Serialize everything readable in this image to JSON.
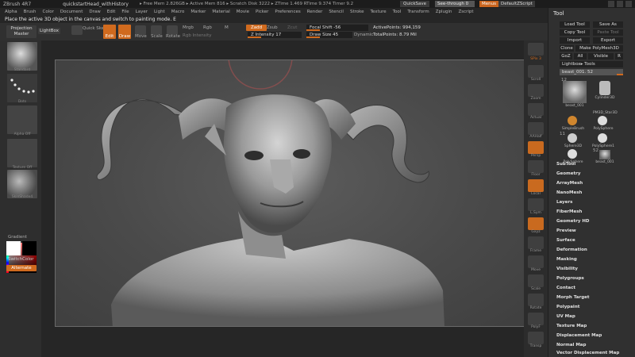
{
  "titlebar": {
    "app": "ZBrush 4R7",
    "file": "quickstartHead_withHistory",
    "stats": "▸ Free Mem 2.826GB ▸ Active Mem 816 ▸ Scratch Disk 3222 ▸ ZTime 1.469 RTime 9.374 Timer 9.2",
    "quicksave": "QuickSave",
    "seethrough": "See-through  0",
    "menus": "Menus",
    "default_script": "DefaultZScript"
  },
  "menubar": [
    "Alpha",
    "Brush",
    "Color",
    "Document",
    "Draw",
    "Edit",
    "File",
    "Layer",
    "Light",
    "Macro",
    "Marker",
    "Material",
    "Movie",
    "Picker",
    "Preferences",
    "Render",
    "Stencil",
    "Stroke",
    "Texture",
    "Tool",
    "Transform",
    "Zplugin",
    "Zscript"
  ],
  "message": "Place the active 3D object in the canvas and switch to painting mode. E",
  "shelf": {
    "projection_master": "Projection Master",
    "lightbox": "LightBox",
    "quick_sketch": "Quick Sketch",
    "edit": "Edit",
    "draw": "Draw",
    "move": "Move",
    "scale": "Scale",
    "rotate": "Rotate",
    "mrgb": "Mrgb",
    "rgb": "Rgb",
    "m": "M",
    "rgb_intensity": "Rgb Intensity",
    "zadd": "Zadd",
    "zsub": "Zsub",
    "zcut": "Zcut",
    "z_intensity": "Z Intensity 17",
    "focal_shift": "Focal Shift -56",
    "draw_size": "Draw Size 45",
    "dynamic": "Dynamic",
    "active_points": "ActivePoints: 994,159",
    "total_points": "TotalPoints: 8.79 Mil"
  },
  "leftshelf": {
    "labels": [
      "Standard",
      "Dots",
      "Alpha Off",
      "Texture Off",
      "SkinShade4"
    ],
    "gradient": "Gradient",
    "switch_color": "SwitchColor",
    "alternate": "Alternate"
  },
  "rightstrip": [
    "BPR",
    "SPix 3",
    "Scroll",
    "Zoom",
    "Actual",
    "AAHalf",
    "Persp",
    "Floor",
    "Local",
    "L.Sym",
    "Gxyz",
    "Frame",
    "Move",
    "Scale",
    "Rotate",
    "PolyF",
    "Transp",
    "Ghost",
    "Solo"
  ],
  "tool": {
    "header": "Tool",
    "load_tool": "Load Tool",
    "save_as": "Save As",
    "copy_tool": "Copy Tool",
    "paste_tool": "Paste Tool",
    "import": "Import",
    "export": "Export",
    "clone": "Clone",
    "make_polymesh": "Make PolyMesh3D",
    "goz": "GoZ",
    "all": "All",
    "visible": "Visible",
    "r": "R",
    "lightbox_tools": "Lightbox▸ Tools",
    "current_tool": "beast_001. 52",
    "count_a": "12",
    "count_b": "11",
    "count_c": "52",
    "thumbs": [
      "beast_001",
      "Cylinder3D",
      "PM3D_Star3D",
      "SimpleBrush",
      "PolySphere",
      "Sphere3D",
      "PolySphere",
      "PolySphere1",
      "beast_001"
    ],
    "subpalettes": [
      "SubTool",
      "Geometry",
      "ArrayMesh",
      "NanoMesh",
      "Layers",
      "FiberMesh",
      "Geometry HD",
      "Preview",
      "Surface",
      "Deformation",
      "Masking",
      "Visibility",
      "Polygroups",
      "Contact",
      "Morph Target",
      "Polypaint",
      "UV Map",
      "Texture Map",
      "Displacement Map",
      "Normal Map",
      "Vector Displacement Map"
    ]
  },
  "colors": {
    "accent": "#d06a1e",
    "panel": "#303030",
    "canvas": "#4e4e4e"
  }
}
